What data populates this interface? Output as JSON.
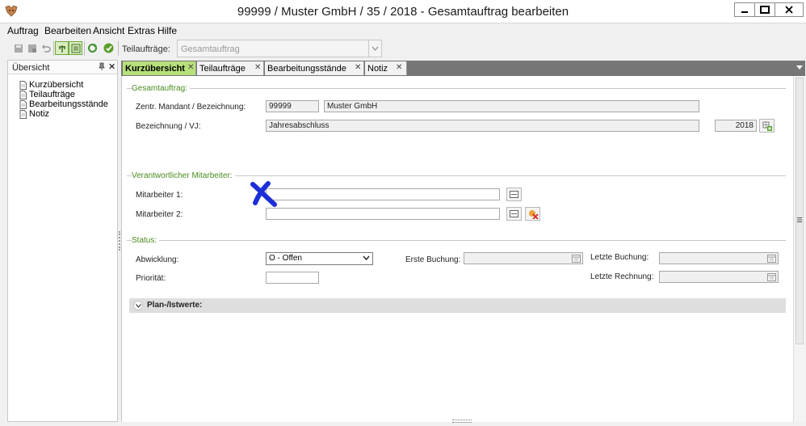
{
  "window": {
    "title": "99999 / Muster GmbH / 35 / 2018 - Gesamtauftrag bearbeiten"
  },
  "menu": {
    "items": [
      "Auftrag",
      "Bearbeiten",
      "Ansicht",
      "Extras",
      "Hilfe"
    ]
  },
  "toolbar": {
    "teilauftraege_label": "Teilaufträge:",
    "teilauftraege_value": "Gesamtauftrag"
  },
  "sidebar": {
    "title": "Übersicht",
    "items": [
      "Kurzübersicht",
      "Teilaufträge",
      "Bearbeitungsstände",
      "Notiz"
    ]
  },
  "tabs": [
    {
      "label": "Kurzübersicht",
      "active": true
    },
    {
      "label": "Teilaufträge",
      "active": false
    },
    {
      "label": "Bearbeitungsstände",
      "active": false
    },
    {
      "label": "Notiz",
      "active": false
    }
  ],
  "gesamtauftrag": {
    "section_title": "Gesamtauftrag:",
    "mandant_label": "Zentr. Mandant / Bezeichnung:",
    "mandant_number": "99999",
    "mandant_name": "Muster GmbH",
    "bezeichnung_label": "Bezeichnung / VJ:",
    "bezeichnung_value": "Jahresabschluss",
    "year_value": "2018"
  },
  "mitarbeiter": {
    "section_title": "Verantwortlicher Mitarbeiter:",
    "m1_label": "Mitarbeiter 1:",
    "m1_value": "",
    "m2_label": "Mitarbeiter 2:",
    "m2_value": ""
  },
  "status": {
    "section_title": "Status:",
    "abwicklung_label": "Abwicklung:",
    "abwicklung_value": "O - Offen",
    "prioritaet_label": "Priorität:",
    "prioritaet_value": "",
    "erste_buchung_label": "Erste Buchung:",
    "erste_buchung_value": "",
    "letzte_buchung_label": "Letzte Buchung:",
    "letzte_buchung_value": "",
    "letzte_rechnung_label": "Letzte Rechnung:",
    "letzte_rechnung_value": ""
  },
  "plan": {
    "group_title": "Plan-/Istwerte:"
  },
  "colors": {
    "active_tab": "#b7e07a",
    "section_title": "#4a8a1e",
    "tabstrip_bg": "#767676",
    "annotation": "#1c2fd6"
  }
}
